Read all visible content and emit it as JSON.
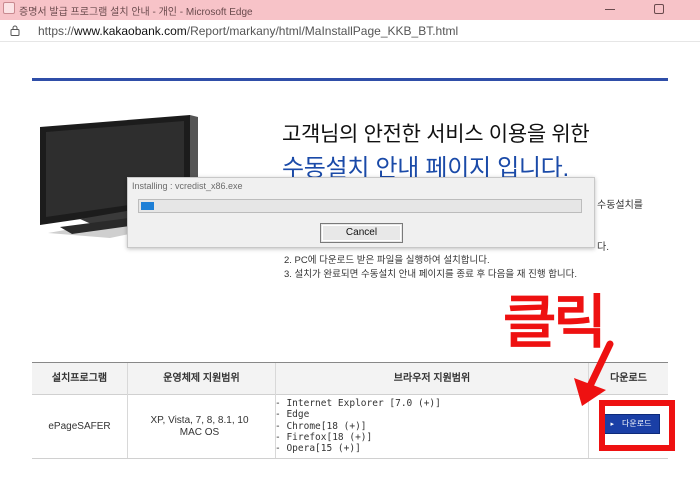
{
  "window": {
    "title": "증명서 발급 프로그램 설치 안내 - 개인 - Microsoft Edge"
  },
  "address_bar": {
    "url_prefix": "https://",
    "url_host": "www.kakaobank.com",
    "url_path": "/Report/markany/html/MaInstallPage_KKB_BT.html"
  },
  "page": {
    "heading_line1": "고객님의 안전한 서비스 이용을 위한",
    "heading_line2": "수동설치 안내 페이지 입니다.",
    "side_text_1": "수동설치를",
    "side_text_2": "다.",
    "step_2": "2. PC에 다운로드 받은 파일을 실행하여 설치합니다.",
    "step_3": "3. 설치가 완료되면 수동설치 안내 페이지를 종료 후 다음을 재 진행 합니다."
  },
  "install_dialog": {
    "title": "Installing : vcredist_x86.exe",
    "progress_percent": 3,
    "cancel_label": "Cancel"
  },
  "annotation": {
    "label": "클릭",
    "color": "#ee1111"
  },
  "table": {
    "headers": [
      "설치프로그램",
      "운영체제 지원범위",
      "브라우저 지원범위",
      "다운로드"
    ],
    "rows": [
      {
        "program": "ePageSAFER",
        "os_line1": "XP, Vista, 7, 8, 8.1, 10",
        "os_line2": "MAC OS",
        "browsers": [
          "- Internet Explorer [7.0 (+)]",
          "- Edge",
          "- Chrome[18 (+)]",
          "- Firefox[18 (+)]",
          "- Opera[15 (+)]"
        ],
        "download_label": "다운로드"
      }
    ]
  },
  "colors": {
    "accent_blue": "#2f4ea8",
    "heading_blue": "#1a4aa8",
    "download_button": "#1a3fa6",
    "titlebar_pink": "#f7c3c8"
  }
}
